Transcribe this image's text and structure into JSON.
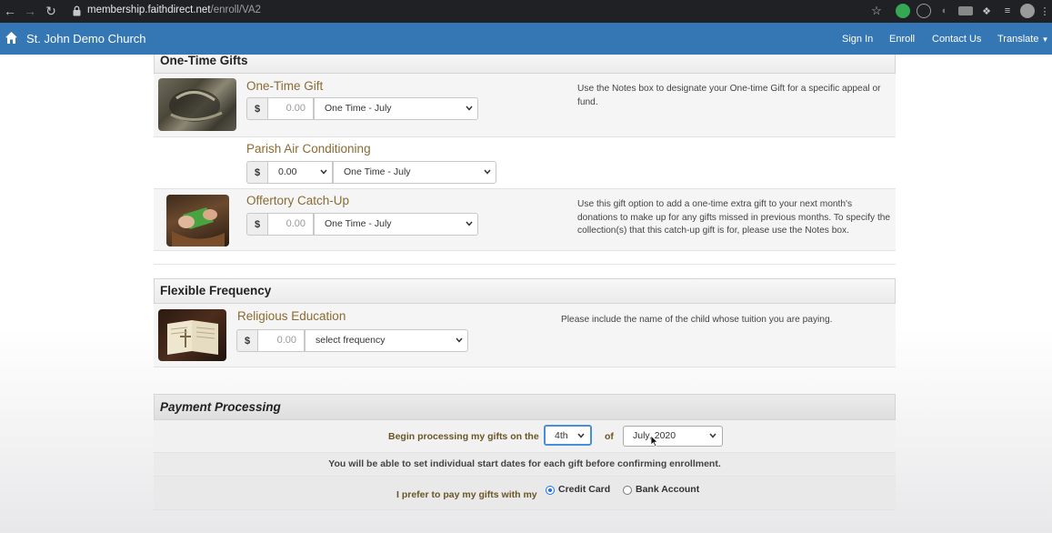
{
  "browser": {
    "url_host": "membership.faithdirect.net",
    "url_path": "/enroll/VA2"
  },
  "navbar": {
    "brand": "St. John Demo Church",
    "links": [
      "Sign In",
      "Enroll",
      "Contact Us"
    ],
    "translate": "Translate"
  },
  "one_time": {
    "heading": "One-Time Gifts",
    "gifts": [
      {
        "title": "One-Time Gift",
        "currency": "$",
        "amount_placeholder": "0.00",
        "frequency": "One Time - July",
        "note": "Use the Notes box to designate your One-time Gift for a specific appeal or fund."
      },
      {
        "title": "Parish Air Conditioning",
        "currency": "$",
        "amount_select": "0.00",
        "frequency": "One Time - July"
      },
      {
        "title": "Offertory Catch-Up",
        "currency": "$",
        "amount_placeholder": "0.00",
        "frequency": "One Time - July",
        "note": "Use this gift option to add a one-time extra gift to your next month's donations to make up for any gifts missed in previous months. To specify the collection(s) that this catch-up gift is for, please use the Notes box."
      }
    ]
  },
  "flexible": {
    "heading": "Flexible Frequency",
    "gifts": [
      {
        "title": "Religious Education",
        "currency": "$",
        "amount_placeholder": "0.00",
        "frequency": "select frequency",
        "note": "Please include the name of the child whose tuition you are paying."
      }
    ]
  },
  "payment": {
    "heading": "Payment Processing",
    "begin_label": "Begin processing my gifts on the",
    "day": "4th",
    "of_label": "of",
    "month": "July, 2020",
    "start_note": "You will be able to set individual start dates for each gift before confirming enrollment.",
    "pay_label": "I prefer to pay my gifts with my",
    "methods": [
      {
        "label": "Credit Card",
        "selected": true
      },
      {
        "label": "Bank Account",
        "selected": false
      }
    ]
  },
  "colors": {
    "navbar": "#3576b5",
    "gift_title": "#8a6b33"
  }
}
